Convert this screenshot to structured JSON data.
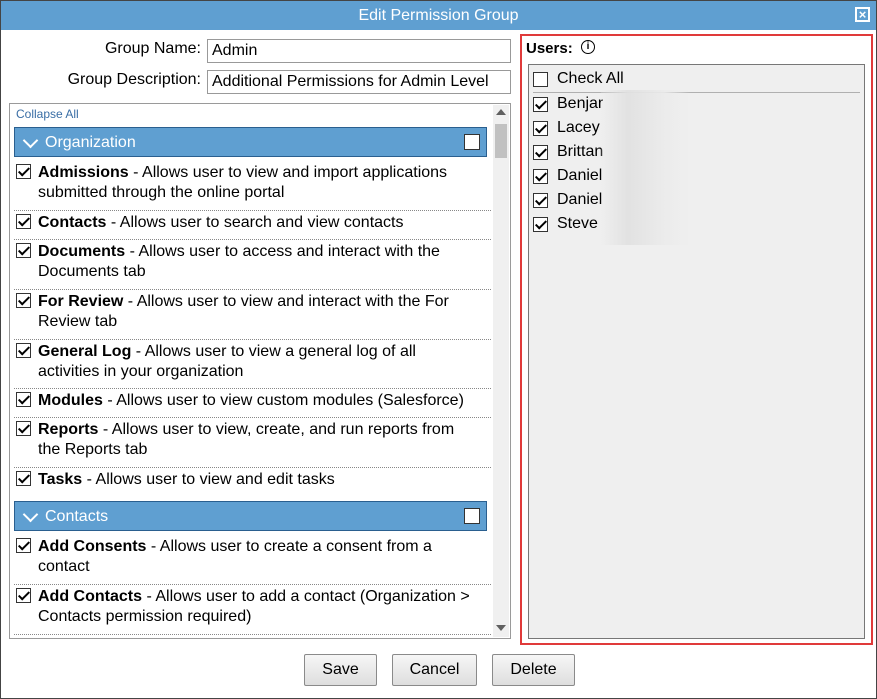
{
  "dialog": {
    "title": "Edit Permission Group",
    "close_label": "×"
  },
  "form": {
    "group_name_label": "Group Name:",
    "group_name_value": "Admin",
    "group_description_label": "Group Description:",
    "group_description_value": "Additional Permissions for Admin Level"
  },
  "permissions": {
    "collapse_all": "Collapse All",
    "sections": [
      {
        "label": "Organization",
        "checked": false
      },
      {
        "label": "Contacts",
        "checked": false
      }
    ],
    "items": [
      {
        "name": "Admissions",
        "desc": " - Allows user to view and import applications submitted through the online portal",
        "checked": true
      },
      {
        "name": "Contacts",
        "desc": " - Allows user to search and view contacts",
        "checked": true
      },
      {
        "name": "Documents",
        "desc": " - Allows user to access and interact with the Documents tab",
        "checked": true
      },
      {
        "name": "For Review",
        "desc": " - Allows user to view and interact with the For Review tab",
        "checked": true
      },
      {
        "name": "General Log",
        "desc": " - Allows user to view a general log of all activities in your organization",
        "checked": true
      },
      {
        "name": "Modules",
        "desc": " - Allows user to view custom modules (Salesforce)",
        "checked": true
      },
      {
        "name": "Reports",
        "desc": " - Allows user to view, create, and run reports from the Reports tab",
        "checked": true
      },
      {
        "name": "Tasks",
        "desc": " - Allows user to view and edit tasks",
        "checked": true
      },
      {
        "name": "Add Consents",
        "desc": " - Allows user to create a consent from a contact",
        "checked": true
      },
      {
        "name": "Add Contacts",
        "desc": " - Allows user to add a contact (Organization > Contacts permission required)",
        "checked": true
      }
    ]
  },
  "users": {
    "label": "Users:",
    "info_icon": "info-icon",
    "check_all_label": "Check All",
    "check_all_checked": false,
    "list": [
      {
        "name": "Benjar",
        "checked": true
      },
      {
        "name": "Lacey",
        "checked": true
      },
      {
        "name": "Brittan",
        "checked": true
      },
      {
        "name": "Daniel",
        "checked": true
      },
      {
        "name": "Daniel",
        "checked": true
      },
      {
        "name": "Steve",
        "checked": true
      }
    ]
  },
  "buttons": {
    "save": "Save",
    "cancel": "Cancel",
    "delete": "Delete"
  },
  "colors": {
    "title_bar": "#5f9fd1",
    "section_header": "#5f9fd1",
    "users_highlight": "#e03a3a",
    "link": "#3a6ea5"
  }
}
